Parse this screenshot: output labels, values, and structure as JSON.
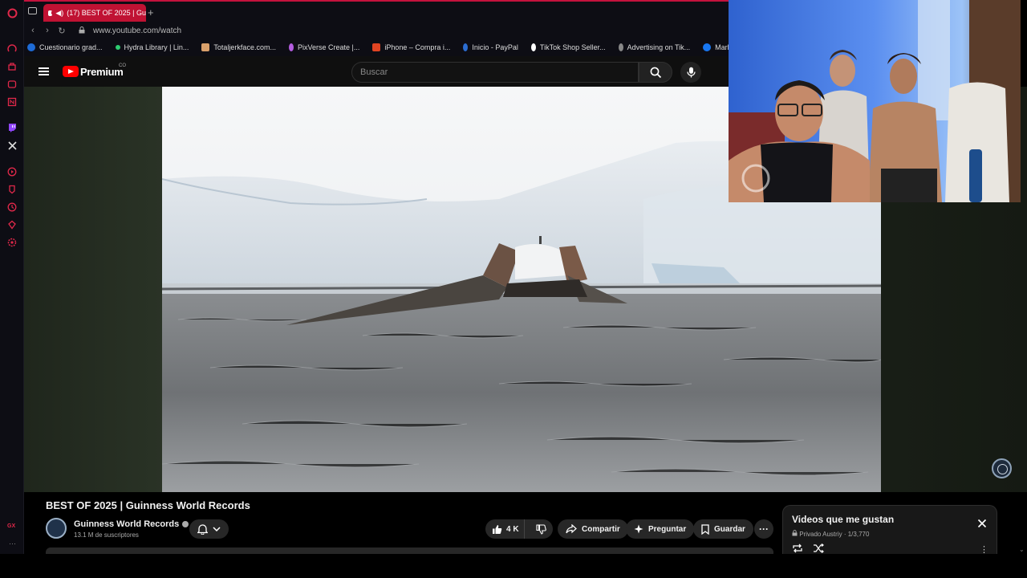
{
  "browser": {
    "tab_title": "(17) BEST OF 2025 | Gu",
    "url": "www.youtube.com/watch",
    "sidebar_label": "GX",
    "bookmarks": [
      {
        "label": "Cuestionario grad...",
        "color": "#1e6bd6"
      },
      {
        "label": "Hydra Library | Lin...",
        "color": "#2ecc71"
      },
      {
        "label": "Totaljerkface.com...",
        "color": "#d9a06b"
      },
      {
        "label": "PixVerse Create |...",
        "color": "#b45de0"
      },
      {
        "label": "iPhone – Compra i...",
        "color": "#e04422"
      },
      {
        "label": "Inicio - PayPal",
        "color": "#2b6dd1"
      },
      {
        "label": "TikTok Shop Seller...",
        "color": "#ffffff"
      },
      {
        "label": "Advertising on Tik...",
        "color": "#888888"
      },
      {
        "label": "Marketplace - Pu",
        "color": "#1877f2"
      }
    ]
  },
  "youtube": {
    "brand": "Premium",
    "country": "CO",
    "search_placeholder": "Buscar"
  },
  "video": {
    "title": "BEST OF 2025 | Guinness World Records",
    "channel": "Guinness World Records",
    "subscribers": "13.1 M de suscriptores",
    "likes": "4 K",
    "share_label": "Compartir",
    "ask_label": "Preguntar",
    "save_label": "Guardar"
  },
  "playlist": {
    "title": "Videos que me gustan",
    "privacy": "Privado",
    "owner": "Austriy",
    "position": "1/3,770"
  },
  "colors": {
    "opera_red": "#c4123d",
    "youtube_red": "#ff0000",
    "background": "#0f0f0f"
  }
}
